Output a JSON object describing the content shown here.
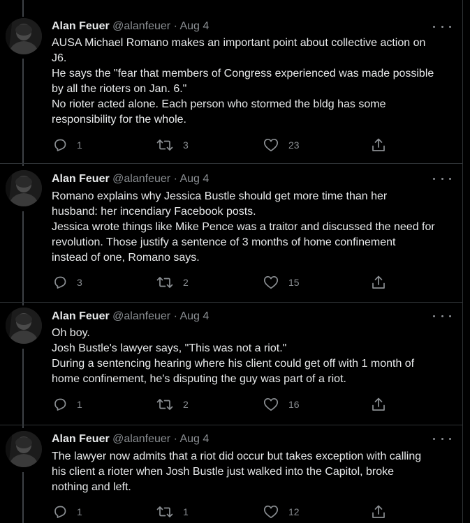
{
  "colors": {
    "background": "#000000",
    "text": "#e7e9ea",
    "muted": "#8b8f93",
    "divider": "#2f3336"
  },
  "tweets": [
    {
      "author": {
        "name": "Alan Feuer",
        "handle": "@alanfeuer"
      },
      "separator": "·",
      "date": "Aug 4",
      "text_lines": [
        "AUSA Michael Romano makes an important point about collective action on",
        "J6.",
        "He says the \"fear that members of Congress experienced was made possible",
        "by all the rioters on Jan. 6.\"",
        "No rioter acted alone. Each person who stormed the bldg has some",
        "responsibility for the whole."
      ],
      "replies": "1",
      "retweets": "3",
      "likes": "23"
    },
    {
      "author": {
        "name": "Alan Feuer",
        "handle": "@alanfeuer"
      },
      "separator": "·",
      "date": "Aug 4",
      "text_lines": [
        "Romano explains why Jessica Bustle should get more time than her",
        "husband: her incendiary Facebook posts.",
        "Jessica wrote things like Mike Pence was a traitor and discussed the need for",
        "revolution. Those justify a sentence of 3 months of home confinement",
        "instead of one, Romano says."
      ],
      "replies": "3",
      "retweets": "2",
      "likes": "15"
    },
    {
      "author": {
        "name": "Alan Feuer",
        "handle": "@alanfeuer"
      },
      "separator": "·",
      "date": "Aug 4",
      "text_lines": [
        "Oh boy.",
        "Josh Bustle's lawyer says, \"This was not a riot.\"",
        "During a sentencing hearing where his client could get off with 1 month of",
        "home confinement, he's disputing the guy was part of a riot."
      ],
      "replies": "1",
      "retweets": "2",
      "likes": "16"
    },
    {
      "author": {
        "name": "Alan Feuer",
        "handle": "@alanfeuer"
      },
      "separator": "·",
      "date": "Aug 4",
      "text_lines": [
        "The lawyer now admits that a riot did occur but takes exception with calling",
        "his client a rioter when Josh Bustle just walked into the Capitol, broke",
        "nothing and left."
      ],
      "replies": "1",
      "retweets": "1",
      "likes": "12"
    }
  ]
}
